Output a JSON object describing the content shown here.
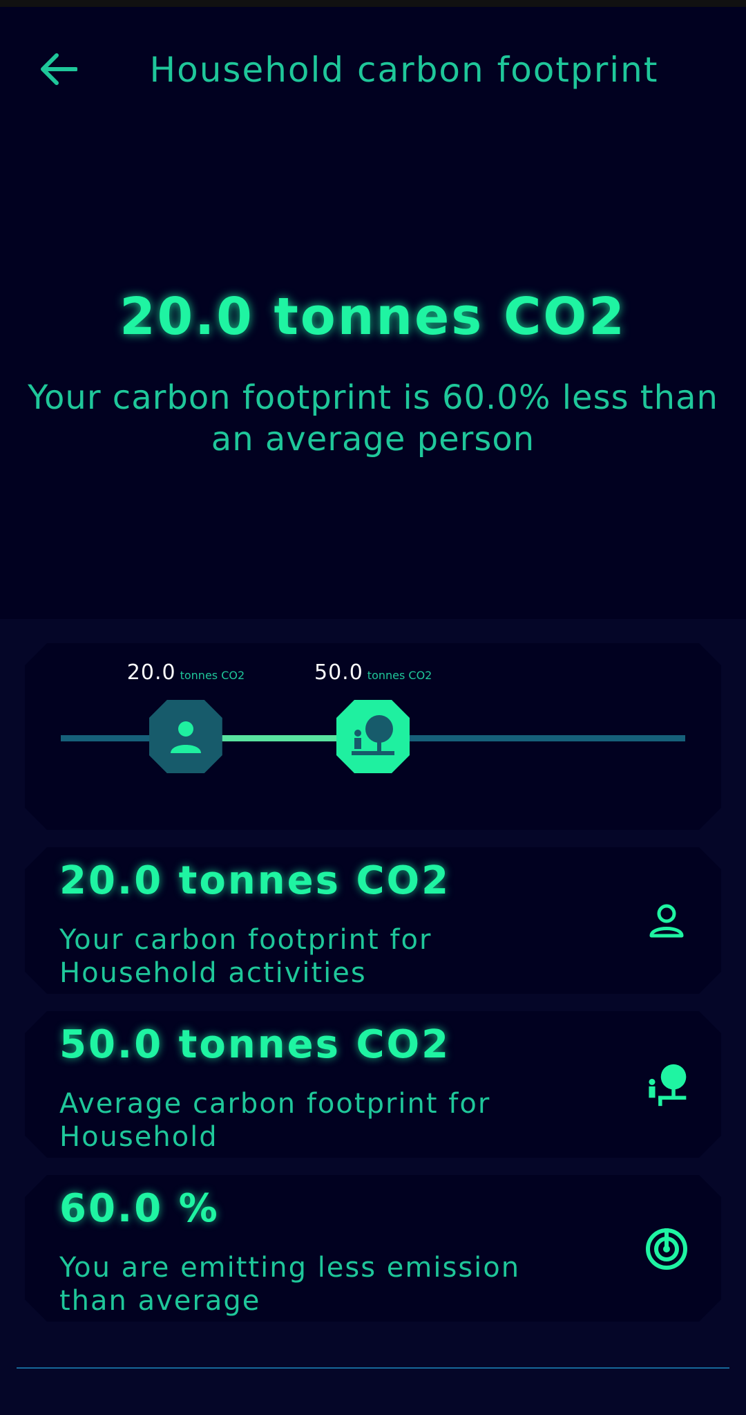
{
  "header": {
    "title": "Household carbon footprint"
  },
  "hero": {
    "value": "20.0 tonnes CO2",
    "description": "Your carbon footprint is 60.0% less than an average person"
  },
  "comparison": {
    "track_max": 100,
    "user": {
      "value": "20.0",
      "unit": "tonnes CO2",
      "amount": 20
    },
    "average": {
      "value": "50.0",
      "unit": "tonnes CO2",
      "amount": 50
    }
  },
  "cards": [
    {
      "value": "20.0 tonnes CO2",
      "description": "Your carbon footprint for Household activities",
      "icon": "person-outline-icon"
    },
    {
      "value": "50.0 tonnes CO2",
      "description": "Average carbon footprint for Household",
      "icon": "person-tree-icon"
    },
    {
      "value": "60.0 %",
      "description": "You are emitting less emission than average",
      "icon": "target-radar-icon"
    }
  ],
  "colors": {
    "accent": "#1ff4a2",
    "text": "#1fc79a",
    "bg_dark": "#010120",
    "bg": "#050628",
    "track": "#16607a"
  }
}
